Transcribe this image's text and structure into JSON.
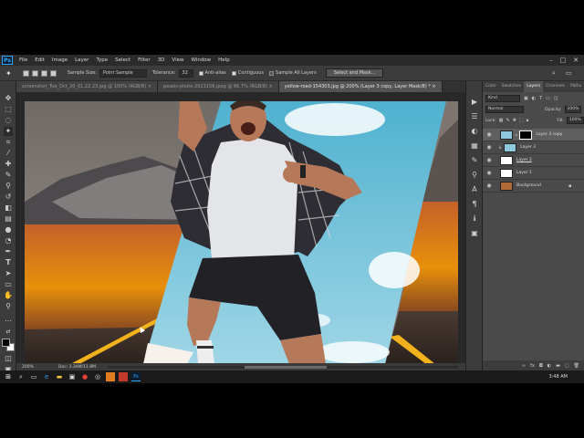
{
  "app": {
    "logo": "Ps"
  },
  "menu": [
    "File",
    "Edit",
    "Image",
    "Layer",
    "Type",
    "Select",
    "Filter",
    "3D",
    "View",
    "Window",
    "Help"
  ],
  "window_controls": {
    "minimize": "–",
    "maximize": "□",
    "close": "✕"
  },
  "options": {
    "sample_size_label": "Sample Size:",
    "sample_size_value": "Point Sample",
    "tolerance_label": "Tolerance:",
    "tolerance_value": "32",
    "anti_alias_label": "Anti-alias",
    "contiguous_label": "Contiguous",
    "sample_all_label": "Sample All Layers",
    "select_mask_label": "Select and Mask..."
  },
  "tabs": [
    {
      "label": "screenshot_Tue_Oct_20_01.22.23.jpg @ 100% (RGB/8) ×"
    },
    {
      "label": "pexels-photo-2923156.jpeg @ 66.7% (RGB/8) ×"
    },
    {
      "label": "yellow-road-154303.jpg @ 200% (Layer 3 copy, Layer Mask/8) * ×"
    }
  ],
  "status": {
    "zoom": "200%",
    "doc": "Doc: 3.34M/11.8M"
  },
  "panels": {
    "tabs": [
      "Color",
      "Swatches",
      "Layers",
      "Channels",
      "Paths"
    ],
    "active_tab": "Layers",
    "kind_label": "Kind",
    "blend_mode": "Normal",
    "opacity_label": "Opacity:",
    "opacity_value": "100%",
    "lock_label": "Lock:",
    "fill_label": "Fill:",
    "fill_value": "100%"
  },
  "layers": [
    {
      "name": "Layer 3 copy",
      "selected": true
    },
    {
      "name": "Layer 3",
      "selected": false
    },
    {
      "name": "Layer 2",
      "selected": false
    },
    {
      "name": "Layer 1",
      "selected": false
    },
    {
      "name": "Background",
      "selected": false
    }
  ],
  "taskbar": {
    "time": "3:48 AM"
  },
  "colors": {
    "accent": "#31a8ff",
    "panel": "#4a4a4a",
    "canvas_bg": "#282828"
  }
}
